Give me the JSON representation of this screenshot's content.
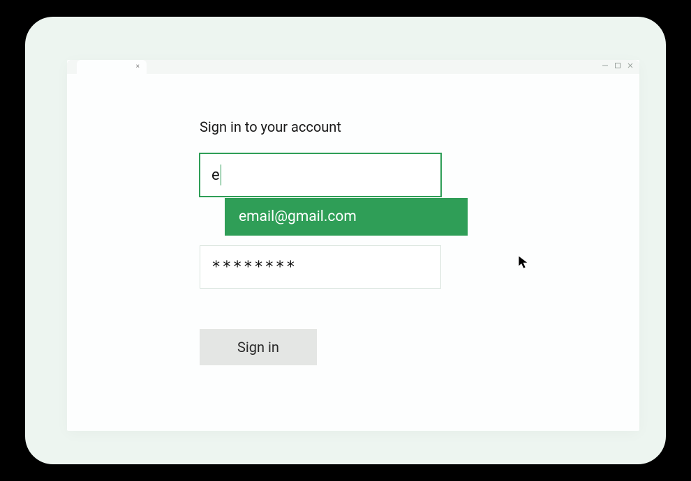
{
  "form": {
    "heading": "Sign in to your account",
    "email_value": "e",
    "autocomplete_suggestion": "email@gmail.com",
    "password_value": "********",
    "signin_label": "Sign in"
  },
  "colors": {
    "accent": "#2f9e57",
    "frame_bg": "#edf5f0"
  }
}
